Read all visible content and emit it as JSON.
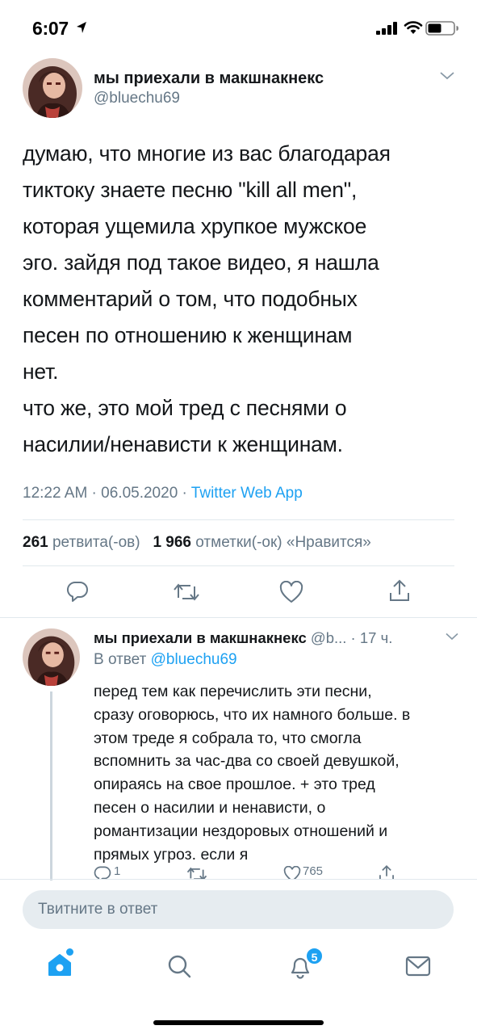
{
  "status_bar": {
    "time": "6:07"
  },
  "icons": {
    "location": "location-arrow-icon",
    "signal": "cellular-signal-icon",
    "wifi": "wifi-icon",
    "battery": "battery-icon",
    "reply": "reply-icon",
    "retweet": "retweet-icon",
    "like": "heart-icon",
    "share": "share-icon",
    "home": "home-icon",
    "search": "search-icon",
    "notifications": "bell-icon",
    "messages": "mail-icon",
    "caret": "chevron-down-icon"
  },
  "tweet": {
    "author_name": "мы приехали в макшнакнекс",
    "author_handle": "@bluechu69",
    "text_lines": [
      "думаю, что многие из вас благодарая",
      "тиктоку знаете песню \"kill all men\",",
      "которая ущемила хрупкое мужское",
      "эго. зайдя под такое видео, я нашла",
      "комментарий о том, что подобных",
      "песен по отношению к женщинам",
      "нет.",
      "что же, это мой тред с песнями о",
      "насилии/ненависти к женщинам."
    ],
    "timestamp": "12:22 AM · 06.05.2020 · ",
    "source": "Twitter Web App",
    "retweets_count": "261",
    "retweets_label": "ретвита(-ов)",
    "likes_count": "1 966",
    "likes_label": "отметки(-ок) «Нравится»"
  },
  "reply": {
    "author_name": "мы приехали в макшнакнекс",
    "handle_and_time": " @b... · 17 ч.",
    "reply_to_label": "В ответ ",
    "reply_to_mention": "@bluechu69",
    "text_lines": [
      "перед тем как перечислить эти песни,",
      "сразу оговорюсь, что их намного больше. в",
      "этом треде я собрала то, что смогла",
      "вспомнить за час-два со своей девушкой,",
      "опираясь на свое прошлое. + это тред",
      "песен о насилии и ненависти, о",
      "романтизации нездоровых отношений и",
      "прямых угроз. если я"
    ],
    "reply_count": "1",
    "like_count": "765"
  },
  "compose": {
    "placeholder": "Твитните в ответ"
  },
  "tabbar": {
    "notifications_badge": "5"
  },
  "colors": {
    "accent": "#1da1f2",
    "text_primary": "#14171a",
    "text_secondary": "#657786",
    "divider": "#e1e8ed",
    "compose_bg": "#e6ecf0"
  }
}
